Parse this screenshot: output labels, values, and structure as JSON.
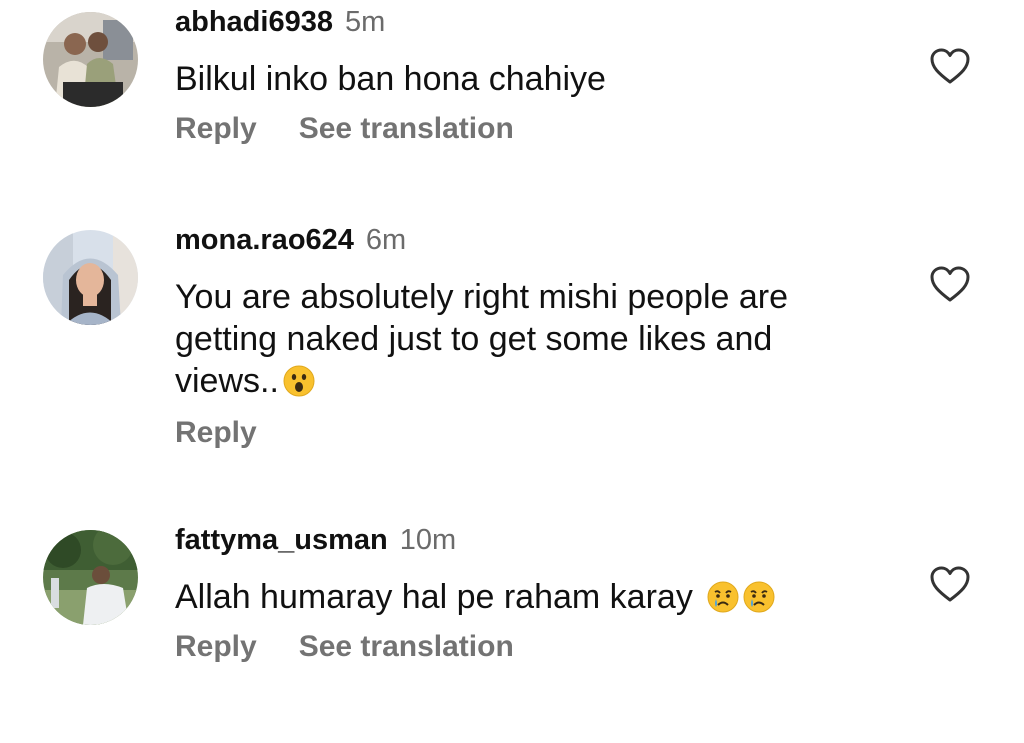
{
  "comments": [
    {
      "username": "abhadi6938",
      "time": "5m",
      "text": "Bilkul inko ban hona chahiye",
      "actions": {
        "reply": "Reply",
        "translate": "See translation"
      }
    },
    {
      "username": "mona.rao624",
      "time": "6m",
      "text_lines": [
        "You are absolutely right mishi people are",
        "getting naked just to get some likes and",
        "views.."
      ],
      "emoji": "😮",
      "actions": {
        "reply": "Reply"
      }
    },
    {
      "username": "fattyma_usman",
      "time": "10m",
      "text": "Allah humaray hal pe raham karay",
      "emojis": [
        "😢",
        "😢"
      ],
      "actions": {
        "reply": "Reply",
        "translate": "See translation"
      }
    }
  ],
  "icons": {
    "like": "heart-outline-icon",
    "surprised": "face-with-open-mouth-emoji",
    "crying": "crying-face-emoji"
  },
  "colors": {
    "username": "#111111",
    "timestamp": "#6b6b6b",
    "action": "#737373",
    "emoji": "#F9C12E"
  }
}
